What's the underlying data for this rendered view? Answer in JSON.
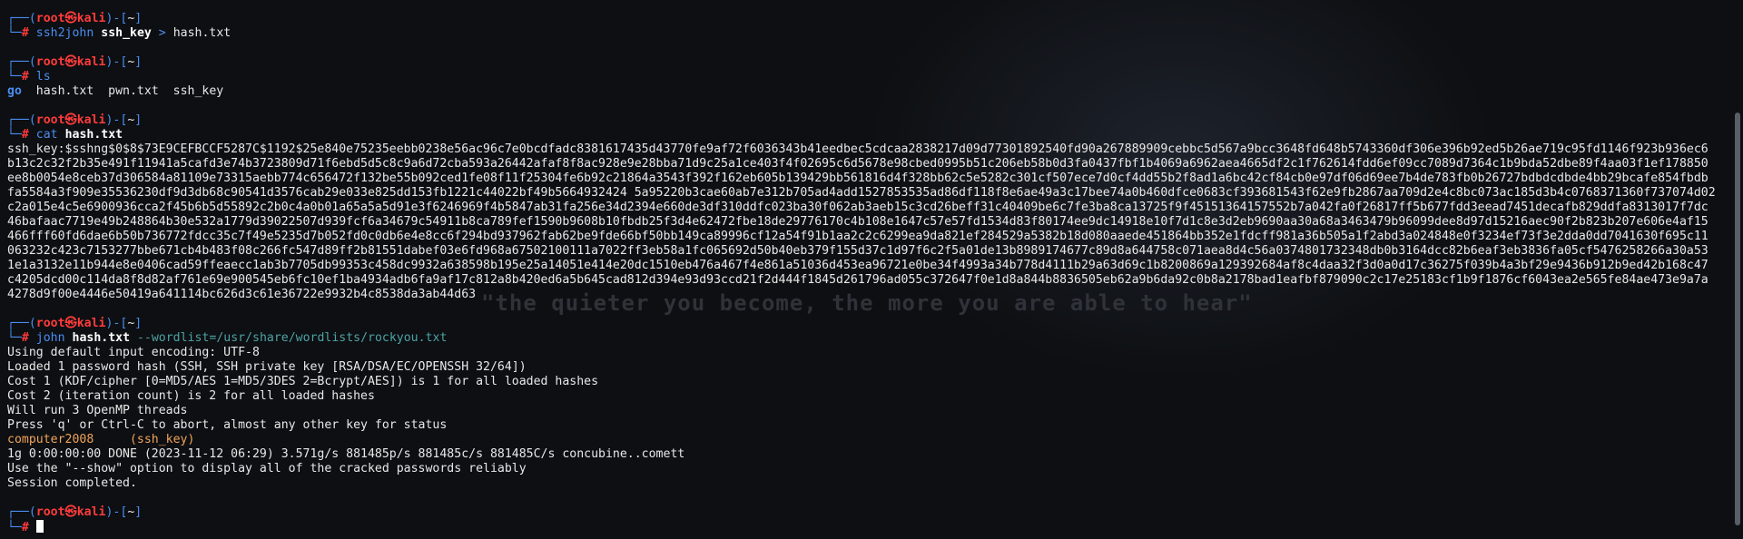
{
  "prompt": {
    "user": "root",
    "at": "㉿",
    "host": "kali",
    "dir": "~",
    "box_top": "┌──(",
    "box_close": ")-[",
    "box_end": "]",
    "box_bottom": "└─",
    "hash_sign": "# "
  },
  "blocks": [
    {
      "cmd": "ssh2john",
      "args": [
        "ssh_key"
      ],
      "op": ">",
      "rest": "hash.txt"
    },
    {
      "cmd": "ls"
    },
    {
      "cmd": "cat",
      "args": [
        "hash.txt"
      ]
    },
    {
      "cmd": "john",
      "args": [
        "hash.txt"
      ],
      "opt": "--wordlist=/usr/share/wordlists/rockyou.txt"
    }
  ],
  "ls_output": {
    "dir": "go",
    "files": "hash.txt  pwn.txt  ssh_key"
  },
  "hash_lines": [
    "ssh_key:$sshng$0$8$73E9CEFBCCF5287C$1192$25e840e75235eebb0238e56ac96c7e0bcdfadc8381617435d43770fe9af72f6036343b41eedbec5cdcaa2838217d09d77301892540fd90a267889909cebbc5d567a9bcc3648fd648b5743360df306e396b92ed5b26ae719c95fd1146f923b936ec6",
    "b13c2c32f2b35e491f11941a5cafd3e74b3723809d71f6ebd5d5c8c9a6d72cba593a26442afaf8f8ac928e9e28bba71d9c25a1ce403f4f02695c6d5678e98cbed0995b51c206eb58b0d3fa0437fbf1b4069a6962aea4665df2c1f762614fdd6ef09cc7089d7364c1b9bda52dbe89f4aa03f1ef178850",
    "ee8b0054e8ceb37d306584a81109e73315aebb774c656472f132be55b092ced1fe08f11f25304fe6b92c21864a3543f392f162eb605b139429bb561816d4f328bb62c5e5282c301cf507ece7d0cf4dd55b2f8ad1a6bc42cf84cb0e97df06d69ee7b4de783fb0b26727bdbdcdbde4bb29bcafe854fbdb",
    "fa5584a3f909e35536230df9d3db68c90541d3576cab29e033e825dd153fb1221c44022bf49b5664932424 5a95220b3cae60ab7e312b705ad4add1527853535ad86df118f8e6ae49a3c17bee74a0b460dfce0683cf393681543f62e9fb2867aa709d2e4c8bc073ac185d3b4c0768371360f737074d02",
    "c2a015e4c5e6900936cca2f45b6b5d55892c2b0c4a0b01a65a5a5d91e3f6246969f4b5847ab31fa256e34d2394e660de3df310ddfc023ba30f062ab3aeb15c3cd26beff31c40409be6c7fe3ba8ca13725f9f45151364157552b7a042fa0f26817ff5b677fdd3eead7451decafb829ddfa8313017f7dc",
    "46bafaac7719e49b248864b30e532a1779d39022507d939fcf6a34679c54911b8ca789fef1590b9608b10fbdb25f3d4e62472fbe18de29776170c4b108e1647c57e57fd1534d83f80174ee9dc14918e10f7d1c8e3d2eb9690aa30a68a3463479b96099dee8d97d15216aec90f2b823b207e606e4af15",
    "466fff60fd6dae6b50b736772fdcc35c7f49e5235d7b052fd0c0db6e4e8cc6f294bd937962fab62be9fde66bf50bb149ca89996cf12a54f91b1aa2c2c6299ea9da821ef284529a5382b18d080aaede451864bb352e1fdcff981a36b505a1f2abd3a024848e0f3234ef73f3e2dda0dd7041630f695c11",
    "063232c423c7153277bbe671cb4b483f08c266fc547d89ff2b81551dabef03e6fd968a67502100111a7022ff3eb58a1fc065692d50b40eb379f155d37c1d97f6c2f5a01de13b8989174677c89d8a644758c071aea8d4c56a0374801732348db0b3164dcc82b6eaf3eb3836fa05cf5476258266a30a53",
    "1e1a3132e11b944e8e0406cad59ffeaecc1ab3b7705db99353c458dc9932a638598b195e25a14051e414e20dc1510eb476a467f4e861a51036d453ea96721e0be34f4993a34b778d4111b29a63d69c1b8200869a129392684af8c4daa32f3d0a0d17c36275f039b4a3bf29e9436b912b9ed42b168c47",
    "c4205dcd00c114da8f8d82af761e69e900545eb6fc10ef1ba4934adb6fa9af17c812a8b420ed6a5b645cad812d394e93d93ccd21f2d444f1845d261796ad055c372647f0e1d8a844b8836505eb62a9b6da92c0b8a2178bad1eafbf879090c2c17e25183cf1b9f1876cf6043ea2e565fe84ae473e9a7a",
    "4278d9f00e4446e50419a641114bc626d3c61e36722e9932b4c8538da3ab44d63"
  ],
  "john_output": {
    "lines_before": [
      "Using default input encoding: UTF-8",
      "Loaded 1 password hash (SSH, SSH private key [RSA/DSA/EC/OPENSSH 32/64])",
      "Cost 1 (KDF/cipher [0=MD5/AES 1=MD5/3DES 2=Bcrypt/AES]) is 1 for all loaded hashes",
      "Cost 2 (iteration count) is 2 for all loaded hashes",
      "Will run 3 OpenMP threads",
      "Press 'q' or Ctrl-C to abort, almost any other key for status"
    ],
    "cracked_password": "computer2008",
    "cracked_pad": "     ",
    "cracked_label": "(ssh_key)",
    "lines_after": [
      "1g 0:00:00:00 DONE (2023-11-12 06:29) 3.571g/s 881485p/s 881485c/s 881485C/s concubine..comett",
      "Use the \"--show\" option to display all of the cracked passwords reliably",
      "Session completed."
    ]
  },
  "watermark": "\"the quieter you become, the more you are able to hear\""
}
